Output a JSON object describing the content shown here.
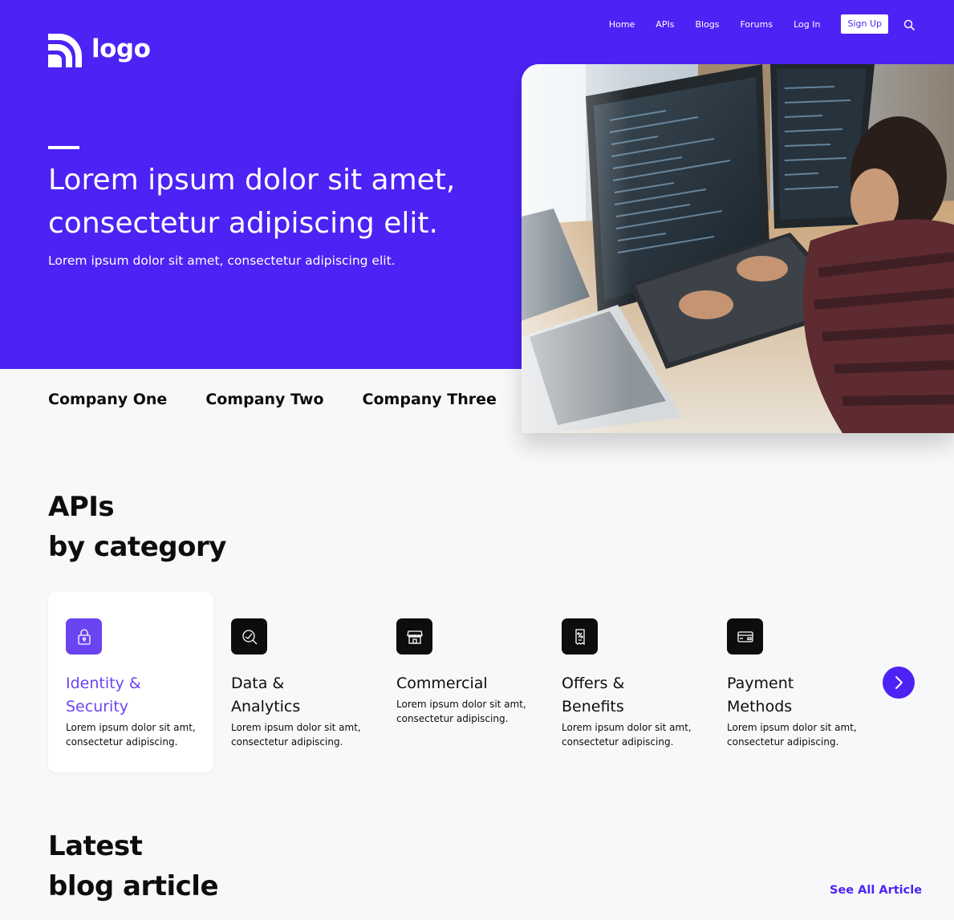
{
  "header": {
    "logo_text": "logo",
    "nav": [
      "Home",
      "APIs",
      "Blogs",
      "Forums",
      "Log In"
    ],
    "signup_label": "Sign Up",
    "icons": {
      "search": "search-icon",
      "logo": "logo-mark-icon"
    }
  },
  "hero": {
    "title": "Lorem ipsum dolor sit amet, consectetur adipiscing elit.",
    "subtitle": "Lorem ipsum dolor sit amet, consectetur adipiscing elit.",
    "image": "developer-at-computer-photo"
  },
  "companies": [
    "Company One",
    "Company Two",
    "Company Three"
  ],
  "apis_section": {
    "title_line1": "APIs",
    "title_line2": "by category",
    "categories": [
      {
        "title_line1": "Identity &",
        "title_line2": "Security",
        "desc_line1": "Lorem ipsum dolor sit amt,",
        "desc_line2": "consectetur adipiscing.",
        "icon": "lock-icon",
        "active": true
      },
      {
        "title_line1": "Data &",
        "title_line2": "Analytics",
        "desc_line1": "Lorem ipsum dolor sit amt,",
        "desc_line2": "consectetur adipiscing.",
        "icon": "analytics-search-icon",
        "active": false
      },
      {
        "title_line1": "Commercial",
        "title_line2": "",
        "desc_line1": "Lorem ipsum dolor sit amt,",
        "desc_line2": "consectetur adipiscing.",
        "icon": "store-icon",
        "active": false
      },
      {
        "title_line1": "Offers &",
        "title_line2": "Benefits",
        "desc_line1": "Lorem ipsum dolor sit amt,",
        "desc_line2": "consectetur adipiscing.",
        "icon": "discount-receipt-icon",
        "active": false
      },
      {
        "title_line1": "Payment",
        "title_line2": "Methods",
        "desc_line1": "Lorem ipsum dolor sit amt,",
        "desc_line2": "consectetur adipiscing.",
        "icon": "credit-card-icon",
        "active": false
      }
    ],
    "next_icon": "chevron-right-icon"
  },
  "blog_section": {
    "title_line1": "Latest",
    "title_line2": "blog article",
    "see_all_label": "See All Article"
  },
  "colors": {
    "primary": "#4d22f5",
    "accent": "#6a44f0",
    "background": "#f7f8fa"
  }
}
